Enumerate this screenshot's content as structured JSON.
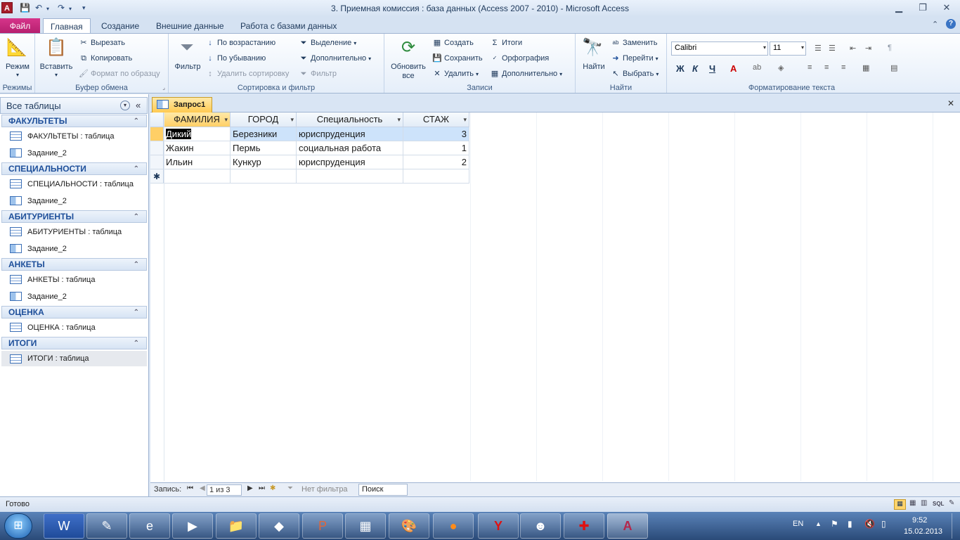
{
  "app": {
    "title": "3. Приемная комиссия : база данных (Access 2007 - 2010)  -  Microsoft Access",
    "icon": "A"
  },
  "ribbon_tabs": [
    {
      "label": "Файл"
    },
    {
      "label": "Главная"
    },
    {
      "label": "Создание"
    },
    {
      "label": "Внешние данные"
    },
    {
      "label": "Работа с базами данных"
    }
  ],
  "ribbon": {
    "groups": {
      "modes": "Режимы",
      "clipboard": "Буфер обмена",
      "sort": "Сортировка и фильтр",
      "records": "Записи",
      "find": "Найти",
      "format": "Форматирование текста"
    },
    "mode_btn": "Режим",
    "paste": "Вставить",
    "cut": "Вырезать",
    "copy": "Копировать",
    "format_painter": "Формат по образцу",
    "filter": "Фильтр",
    "sort_asc": "По возрастанию",
    "sort_desc": "По убыванию",
    "remove_sort": "Удалить сортировку",
    "selection": "Выделение",
    "advanced": "Дополнительно",
    "toggle_filter": "Фильтр",
    "refresh_all": "Обновить",
    "refresh_all2": "все",
    "new": "Создать",
    "save": "Сохранить",
    "delete": "Удалить",
    "totals": "Итоги",
    "spelling": "Орфография",
    "more": "Дополнительно",
    "find": "Найти",
    "replace": "Заменить",
    "goto": "Перейти",
    "select": "Выбрать",
    "font": "Calibri",
    "size": "11",
    "bold": "Ж",
    "italic": "К",
    "underline": "Ч"
  },
  "nav": {
    "header": "Все таблицы",
    "groups": [
      {
        "name": "ФАКУЛЬТЕТЫ",
        "items": [
          "ФАКУЛЬТЕТЫ : таблица",
          "Задание_2"
        ]
      },
      {
        "name": "СПЕЦИАЛЬНОСТИ",
        "items": [
          "СПЕЦИАЛЬНОСТИ : таблица",
          "Задание_2"
        ]
      },
      {
        "name": "АБИТУРИЕНТЫ",
        "items": [
          "АБИТУРИЕНТЫ : таблица",
          "Задание_2"
        ]
      },
      {
        "name": "АНКЕТЫ",
        "items": [
          "АНКЕТЫ : таблица",
          "Задание_2"
        ]
      },
      {
        "name": "ОЦЕНКА",
        "items": [
          "ОЦЕНКА : таблица"
        ]
      },
      {
        "name": "ИТОГИ",
        "items": [
          "ИТОГИ : таблица"
        ]
      }
    ]
  },
  "document": {
    "tab": "Запрос1",
    "columns": [
      "ФАМИЛИЯ",
      "ГОРОД",
      "Специальность",
      "СТАЖ"
    ],
    "rows": [
      [
        "Дикий",
        "Березники",
        "юриспруденция",
        "3"
      ],
      [
        "Жакин",
        "Пермь",
        "социальная работа",
        "1"
      ],
      [
        "Ильин",
        "Кункур",
        "юриспруденция",
        "2"
      ]
    ],
    "new_row_marker": "✱"
  },
  "record_nav": {
    "label": "Запись:",
    "position": "1 из 3",
    "filter": "Нет фильтра",
    "search": "Поиск"
  },
  "status": {
    "text": "Готово"
  },
  "taskbar": {
    "lang": "EN",
    "time": "9:52",
    "date": "15.02.2013"
  }
}
